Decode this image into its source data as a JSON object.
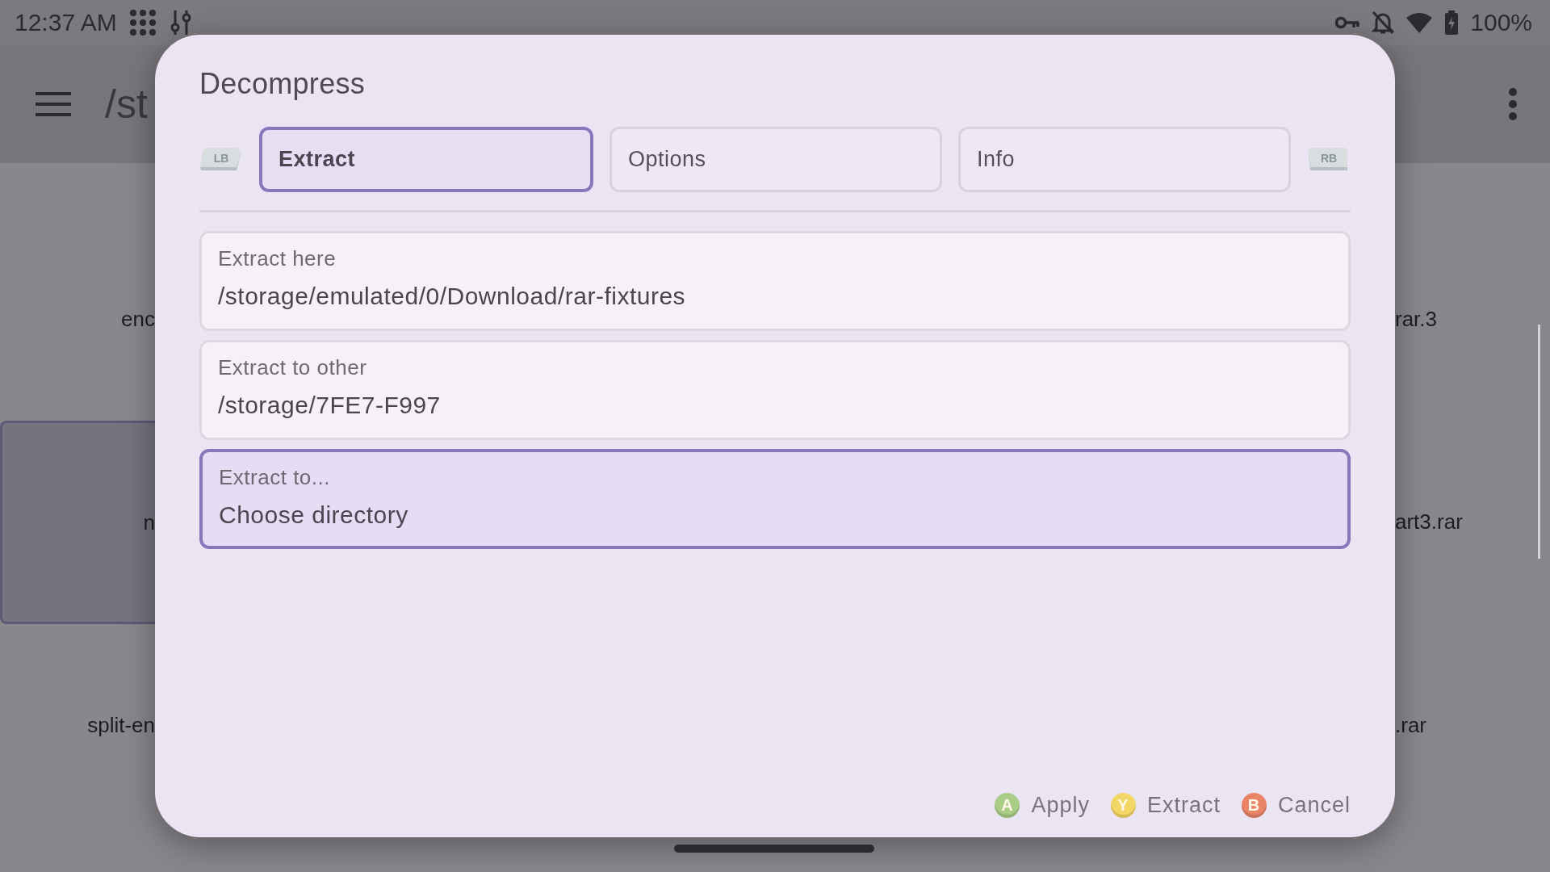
{
  "status_bar": {
    "time": "12:37 AM",
    "battery": "100%"
  },
  "app_bar": {
    "path": "/st"
  },
  "file_grid": {
    "left_column": [
      {
        "label": "enc",
        "selected": false
      },
      {
        "label": "n",
        "selected": true
      },
      {
        "label": "split-en",
        "selected": false
      }
    ],
    "right_column": [
      {
        "label": "rar.3",
        "selected": false
      },
      {
        "label": "art3.rar",
        "selected": false
      },
      {
        "label": ".rar",
        "selected": false
      }
    ]
  },
  "dialog": {
    "title": "Decompress",
    "left_shoulder": "LB",
    "right_shoulder": "RB",
    "tabs": [
      {
        "label": "Extract",
        "selected": true
      },
      {
        "label": "Options",
        "selected": false
      },
      {
        "label": "Info",
        "selected": false
      }
    ],
    "options": [
      {
        "label": "Extract here",
        "value": "/storage/emulated/0/Download/rar-fixtures",
        "selected": false
      },
      {
        "label": "Extract to other",
        "value": "/storage/7FE7-F997",
        "selected": false
      },
      {
        "label": "Extract to...",
        "value": "Choose directory",
        "selected": true
      }
    ],
    "actions": [
      {
        "key": "A",
        "label": "Apply",
        "color": "#a9cc86"
      },
      {
        "key": "Y",
        "label": "Extract",
        "color": "#f3d766"
      },
      {
        "key": "B",
        "label": "Cancel",
        "color": "#e98566"
      }
    ]
  }
}
